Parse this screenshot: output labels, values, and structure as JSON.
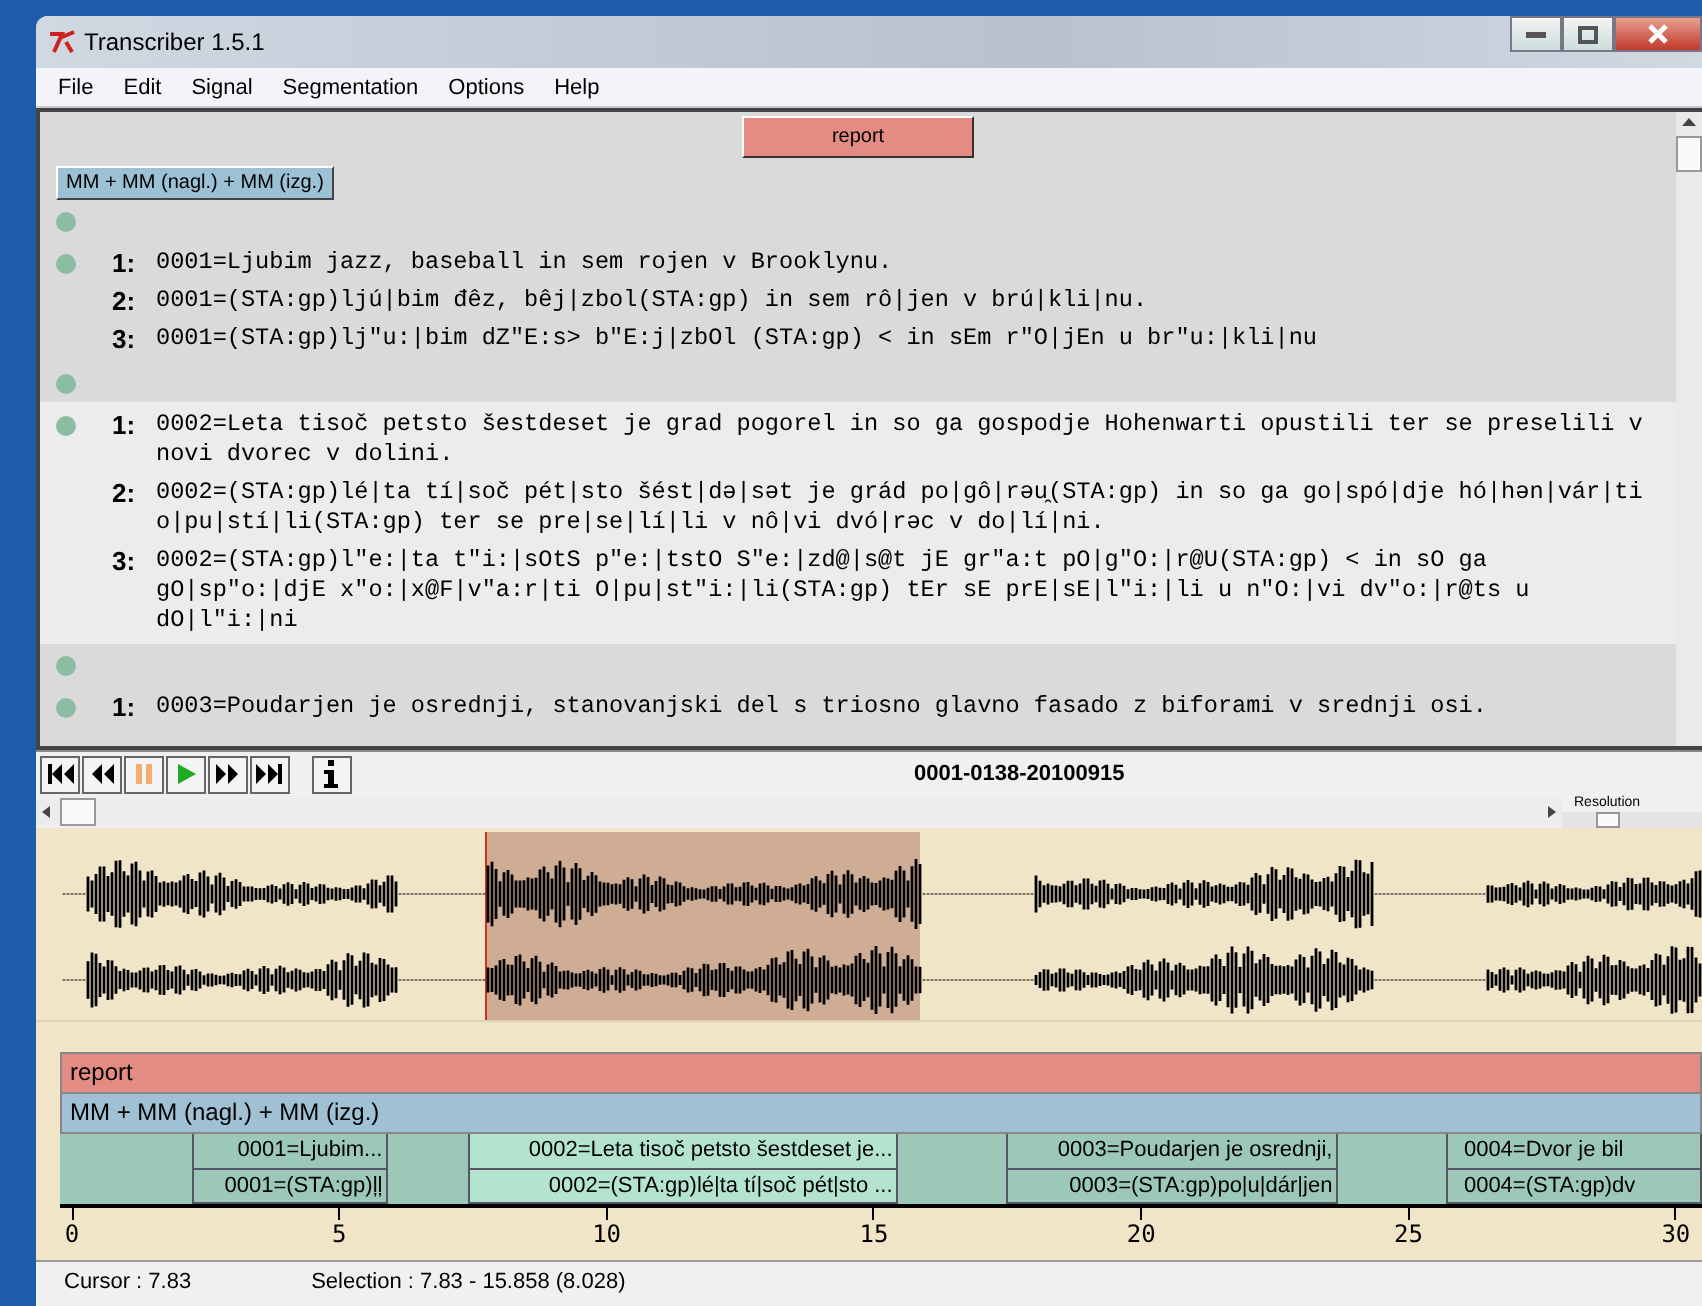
{
  "window": {
    "title": "Transcriber 1.5.1"
  },
  "menu": [
    "File",
    "Edit",
    "Signal",
    "Segmentation",
    "Options",
    "Help"
  ],
  "topic_button": "report",
  "speaker_button": "MM + MM (nagl.) + MM (izg.)",
  "transcript": [
    {
      "kind": "marker",
      "selected": false
    },
    {
      "kind": "segment",
      "selected": false,
      "lines": [
        {
          "num": "1:",
          "text": "0001=Ljubim jazz, baseball in sem rojen v Brooklynu."
        },
        {
          "num": "2:",
          "text": "0001=(STA:gp)ljú|bim đêz, bêj|zbol(STA:gp) in sem rô|jen v brú|kli|nu."
        },
        {
          "num": "3:",
          "text": "0001=(STA:gp)lj\"u:|bim dZ\"E:s> b\"E:j|zbOl (STA:gp) < in sEm r\"O|jEn u br\"u:|kli|nu"
        }
      ]
    },
    {
      "kind": "marker",
      "selected": false
    },
    {
      "kind": "segment",
      "selected": true,
      "lines": [
        {
          "num": "1:",
          "text": "0002=Leta tisoč petsto šestdeset je grad pogorel in so ga gospodje Hohenwarti opustili ter se preselili v novi dvorec v dolini."
        },
        {
          "num": "2:",
          "text": "0002=(STA:gp)lé|ta tí|soč pét|sto šést|də|sət je grád po|gô|rəu̯(STA:gp) in so ga go|spó|dje hó|hən|vár|ti o|pu|stí|li(STA:gp) ter se pre|se|lí|li v nô|vi dvó|rəc v do|lí|ni."
        },
        {
          "num": "3:",
          "text": "0002=(STA:gp)l\"e:|ta t\"i:|sOtS p\"e:|tstO S\"e:|zd@|s@t jE gr\"a:t pO|g\"O:|r@U(STA:gp) < in sO ga gO|sp\"o:|djE x\"o:|x@F|v\"a:r|ti O|pu|st\"i:|li(STA:gp) tEr sE prE|sE|l\"i:|li u n\"O:|vi dv\"o:|r@ts u dO|l\"i:|ni"
        }
      ]
    },
    {
      "kind": "marker",
      "selected": false
    },
    {
      "kind": "segment",
      "selected": false,
      "lines": [
        {
          "num": "1:",
          "text": "0003=Poudarjen je osrednji, stanovanjski del s triosno glavno fasado z biforami v srednji osi."
        }
      ]
    }
  ],
  "player": {
    "title": "0001-0138-20100915",
    "playing": false,
    "resolution": {
      "label": "Resolution",
      "level": 0.3
    }
  },
  "tracks": {
    "topic": "report",
    "speaker": "MM + MM (nagl.) + MM (izg.)",
    "segments": [
      {
        "kind": "gap",
        "selected": false
      },
      {
        "kind": "segment",
        "selected": false,
        "top": "0001=Ljubim...",
        "bottom": "0001=(STA:gp)ļļ"
      },
      {
        "kind": "gap",
        "selected": false
      },
      {
        "kind": "segment",
        "selected": true,
        "top": "0002=Leta tisoč petsto šestdeset je...",
        "bottom": "0002=(STA:gp)lé|ta tí|soč pét|sto ..."
      },
      {
        "kind": "gap",
        "selected": false
      },
      {
        "kind": "segment",
        "selected": false,
        "top": "0003=Poudarjen je osrednji,",
        "bottom": "0003=(STA:gp)po|u|dár|jen"
      },
      {
        "kind": "gap",
        "selected": false
      },
      {
        "kind": "segment",
        "selected": false,
        "top": "0004=Dvor je bil",
        "bottom": "0004=(STA:gp)dv"
      }
    ]
  },
  "axis": [
    "0",
    "5",
    "10",
    "15",
    "20",
    "25",
    "30"
  ],
  "status": {
    "cursor": "Cursor : 7.83",
    "selection": "Selection : 7.83 - 15.858 (8.028)"
  }
}
